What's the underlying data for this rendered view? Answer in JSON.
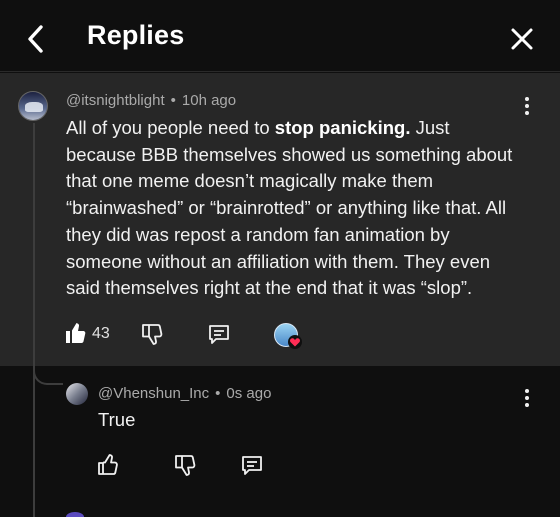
{
  "header": {
    "title": "Replies",
    "back_icon": "chevron-left-icon",
    "close_icon": "close-icon"
  },
  "parent_comment": {
    "handle": "@itsnightblight",
    "separator": "•",
    "time": "10h ago",
    "text_before": "All of you people need to ",
    "text_bold": "stop panicking.",
    "text_after": " Just because BBB themselves showed us something about that one meme doesn’t magically make them “brainwashed” or “brainrotted” or anything like that. All they did was repost a random fan animation by someone without an affiliation with them. They even said themselves right at the end that it was “slop”.",
    "like_count": "43",
    "creator_heart": true
  },
  "reply": {
    "handle": "@Vhenshun_Inc",
    "separator": "•",
    "time": "0s ago",
    "text": "True"
  },
  "colors": {
    "background": "#0f0f0f",
    "highlight_background": "#272727",
    "meta_text": "#aaaaaa",
    "heart": "#ff2d55"
  }
}
